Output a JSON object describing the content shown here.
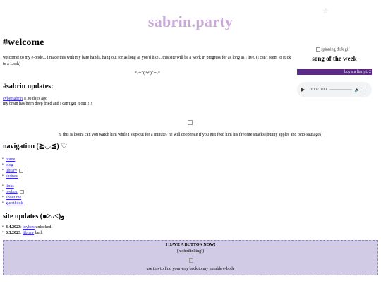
{
  "header": {
    "star": "☆",
    "site_title": "sabrin.party"
  },
  "welcome": {
    "heading": "#welcome",
    "text": "welcome! to my e-bode... i made this with my bare hands. hang out for as long as you'd like... this site will be a work in progress for as long as i live. (i can't seem to stick to a Look)",
    "kaomoji": "°˖✧◝(⁰▿⁰)◜✧˖°"
  },
  "updates": {
    "heading": "#sabrin updates:",
    "author": "cybersabrin",
    "separator": "▯",
    "time": "30 days ago",
    "body": "my brain has been deep fried and i can't get it out!!!!"
  },
  "sidebar": {
    "disk_alt": "spinning disk gif",
    "song_heading": "song of the week",
    "song_title": "boy's a liar pt. 2",
    "player": {
      "time": "0:00 / 0:00",
      "play_icon": "play-icon",
      "volume_icon": "volume-icon",
      "menu_icon": "more-vert-icon"
    }
  },
  "loomi": {
    "caption": "hi this is loomi can you watch him while i step out for a minute? he will cooperate if you just feed him his favorite snacks (bunny apples and octo-sausages)"
  },
  "navigation": {
    "heading": "navigation (≧◡≦) ♡",
    "group_a": [
      "home",
      "blog",
      "library",
      "shrines"
    ],
    "group_b": [
      "links",
      "toybox",
      "about me",
      "guestbook"
    ]
  },
  "site_updates": {
    "heading": "site updates (๑˃ᴗ˂)ﻭ",
    "items": [
      {
        "date": "3.4.2023",
        "link": "toybox",
        "text": " unlocked!"
      },
      {
        "date": "3.3.2023",
        "link": "library",
        "text": " built"
      }
    ]
  },
  "button_box": {
    "title": "I HAVE A BUTTON NOW!",
    "subtitle": "(no hotlinking!)",
    "caption": "use this to find your way back to my humble e-bode"
  },
  "colors": {
    "title": "#c9a9d6",
    "song_bar": "#5b2a86",
    "button_box_bg": "#d1cbe6",
    "link": "#3a2ecc"
  }
}
